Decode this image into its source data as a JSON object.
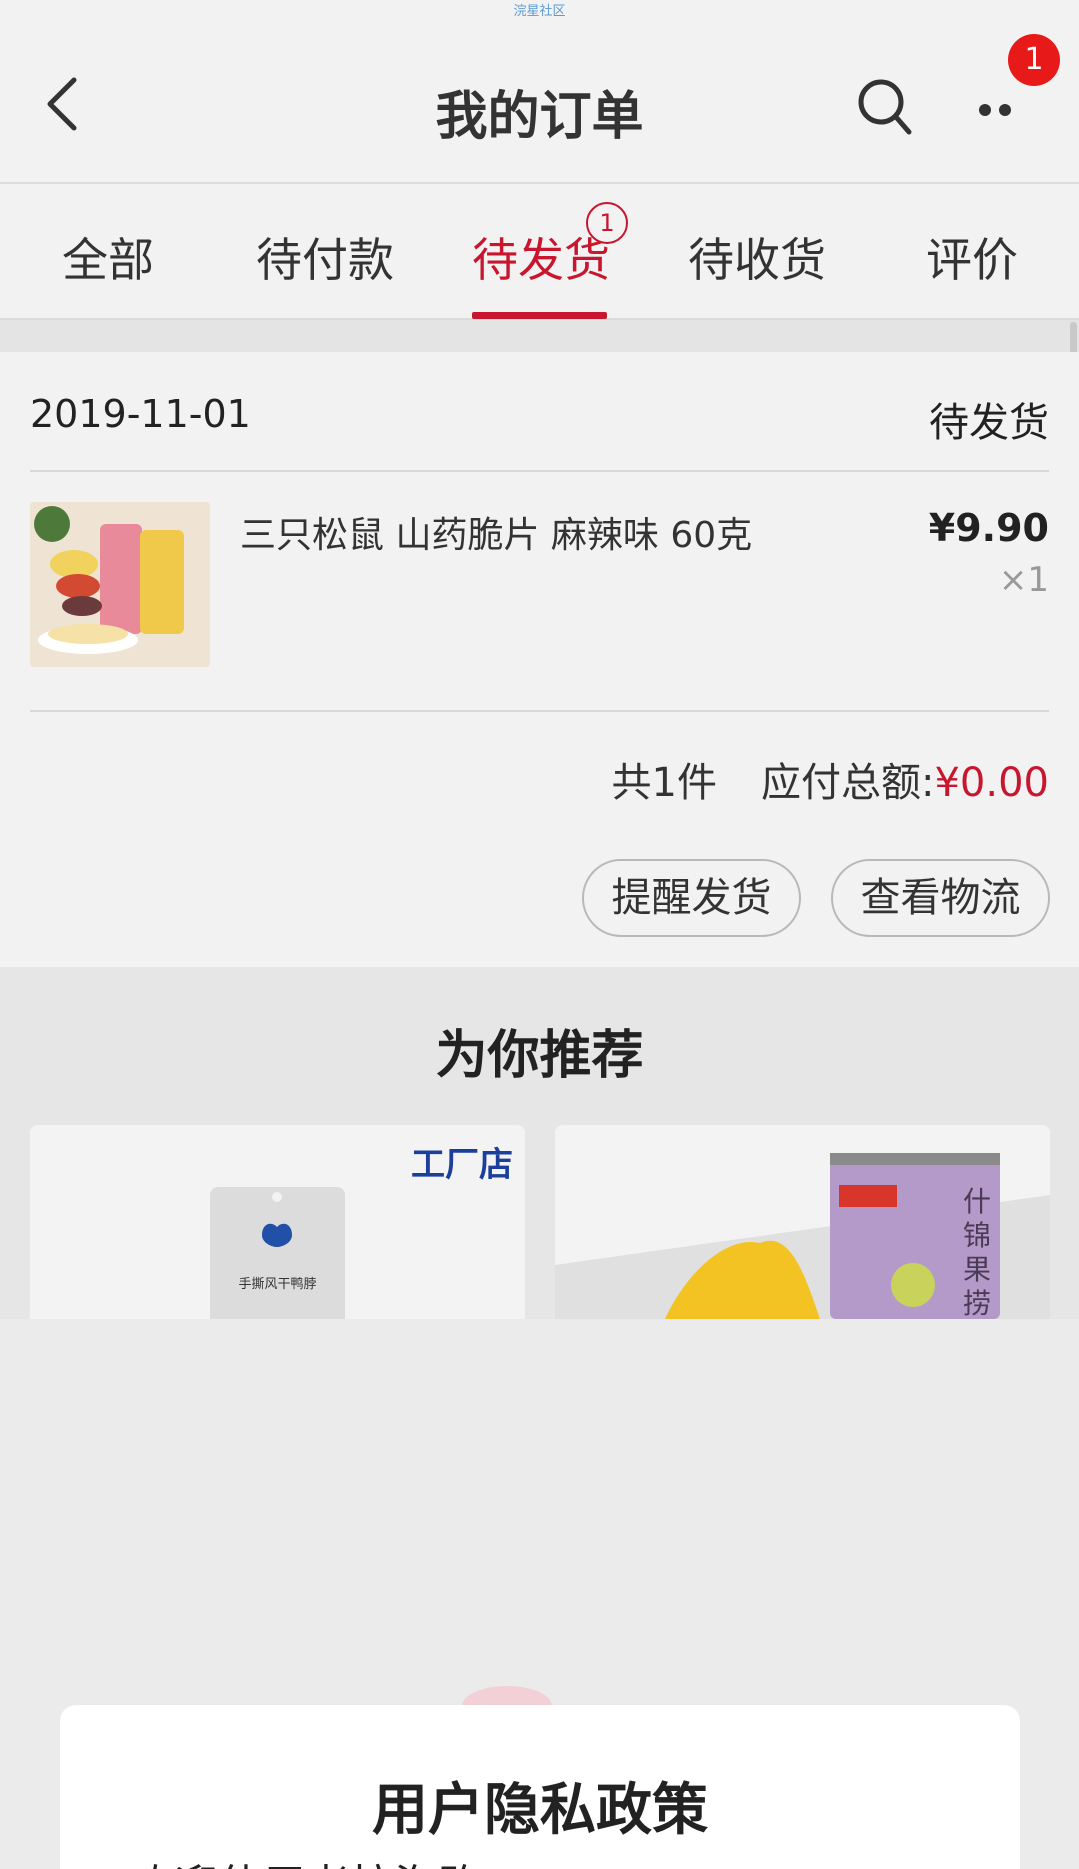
{
  "watermark": "浣星社区",
  "header": {
    "title": "我的订单",
    "more_badge": "1"
  },
  "tabs": [
    {
      "label": "全部"
    },
    {
      "label": "待付款"
    },
    {
      "label": "待发货",
      "badge": "1",
      "active": true
    },
    {
      "label": "待收货"
    },
    {
      "label": "评价"
    }
  ],
  "order": {
    "date": "2019-11-01",
    "status": "待发货",
    "product_name": "三只松鼠 山药脆片 麻辣味 60克",
    "price": "¥9.90",
    "quantity": "×1",
    "count_text": "共1件",
    "total_label": "应付总额:",
    "total_amount": "¥0.00",
    "buttons": {
      "remind": "提醒发货",
      "logistics": "查看物流"
    }
  },
  "recommend": {
    "title": "为你推荐",
    "cards": [
      {
        "tag": "工厂店",
        "product_label": "手撕风干鸭脖"
      },
      {
        "product_label": "什锦果捞"
      }
    ]
  },
  "modal": {
    "title": "用户隐私政策",
    "text": "欢迎使用考拉海购!"
  },
  "colors": {
    "accent": "#c8162e",
    "badge": "#e81919",
    "factory_blue": "#1c3f9c"
  }
}
